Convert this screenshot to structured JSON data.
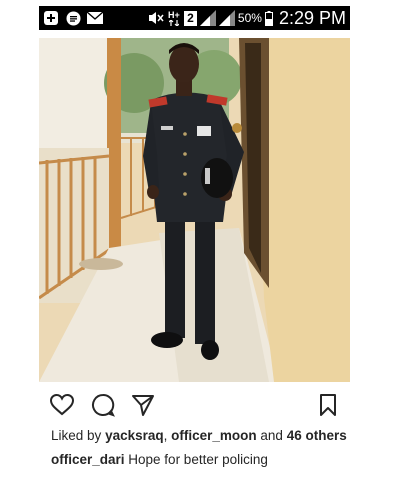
{
  "status_bar": {
    "notification_count": "2",
    "network_type": "H+",
    "battery_percent": "50%",
    "time": "2:29 PM",
    "icons": [
      "add-icon",
      "message-icon",
      "mail-icon",
      "mute-icon",
      "network-icon",
      "signal-icon",
      "signal-icon",
      "battery-icon"
    ]
  },
  "post": {
    "photo_subject": "photo",
    "actions": {
      "like_icon": "heart-icon",
      "comment_icon": "comment-icon",
      "share_icon": "send-icon",
      "save_icon": "bookmark-icon"
    },
    "likes": {
      "prefix": "Liked by",
      "user1": "yacksraq",
      "separator": ", ",
      "user2": "officer_moon",
      "and": " and ",
      "others": "46 others"
    },
    "caption": {
      "username": "officer_dari",
      "text": " Hope for better policing"
    }
  }
}
